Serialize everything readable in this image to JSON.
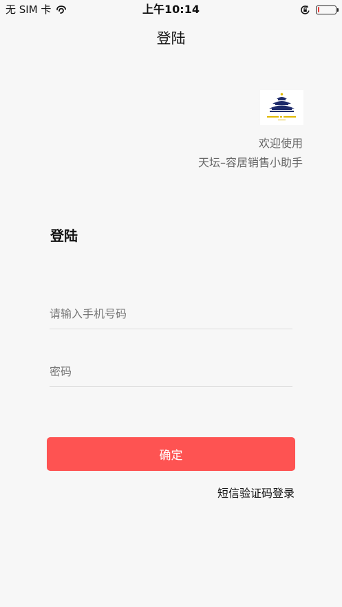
{
  "status_bar": {
    "carrier": "无 SIM 卡",
    "time": "上午10:14",
    "battery_level": 0.12,
    "battery_color": "#e53935",
    "icons": [
      "wifi-link-icon",
      "orientation-lock-icon",
      "battery-icon"
    ]
  },
  "nav": {
    "title": "登陆"
  },
  "logo": {
    "icon": "temple-of-heaven-logo"
  },
  "welcome": {
    "line1": "欢迎使用",
    "line2": "天坛–容居销售小助手"
  },
  "form": {
    "title": "登陆",
    "phone_placeholder": "请输入手机号码",
    "phone_value": "",
    "password_placeholder": "密码",
    "password_value": "",
    "confirm_label": "确定",
    "sms_login_label": "短信验证码登录"
  },
  "colors": {
    "accent": "#fe5352",
    "background": "#f7f7f7",
    "logo_navy": "#1e2b6b",
    "logo_gold": "#e0b800"
  }
}
